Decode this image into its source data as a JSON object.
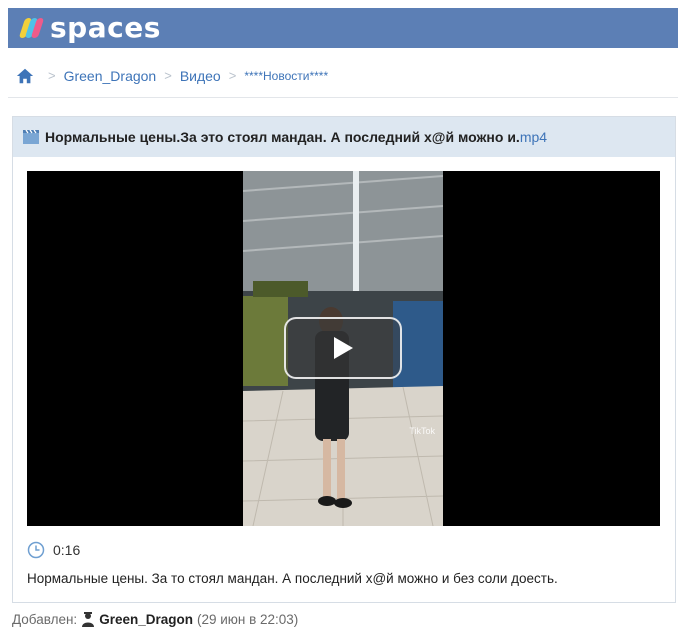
{
  "header": {
    "logo_text": "spaces",
    "logo_colors": [
      "#f2d03a",
      "#4fc2e8",
      "#ef5b8a"
    ],
    "bar_color": "#5c7fb5"
  },
  "breadcrumb": {
    "home_icon": "home-icon",
    "items": [
      "Green_Dragon",
      "Видео",
      "****Новости****"
    ]
  },
  "video": {
    "title": "Нормальные цены.За это стоял мандан. А последний х@й можно и.",
    "extension": "mp4",
    "duration": "0:16",
    "watermark": "TikTok",
    "description": "Нормальные цены. За то стоял мандан. А последний х@й можно и без соли доесть."
  },
  "meta": {
    "added_label": "Добавлен:",
    "author": "Green_Dragon",
    "date": "(29 июн в 22:03)"
  }
}
